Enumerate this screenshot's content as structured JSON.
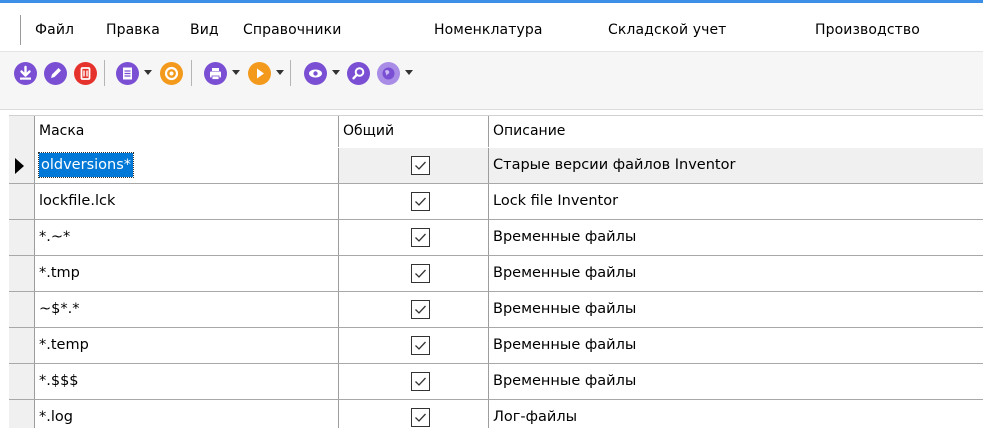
{
  "menu": [
    {
      "id": "file",
      "label": "Файл"
    },
    {
      "id": "edit",
      "label": "Правка"
    },
    {
      "id": "view",
      "label": "Вид"
    },
    {
      "id": "references",
      "label": "Справочники"
    },
    {
      "id": "nomenclature",
      "label": "Номенклатура"
    },
    {
      "id": "warehouse",
      "label": "Складской учет"
    },
    {
      "id": "production",
      "label": "Производство"
    }
  ],
  "toolbar": {
    "icons": [
      "download-icon",
      "edit-icon",
      "delete-icon",
      "document-icon",
      "refresh-icon",
      "print-icon",
      "play-icon",
      "view-icon",
      "search-icon",
      "globe-icon"
    ],
    "colors": {
      "purple": "#7a4fd3",
      "red": "#e5322d",
      "orange": "#f39a1c",
      "blue_accent": "#3d8ee6"
    }
  },
  "grid": {
    "columns": [
      "Маска",
      "Общий",
      "Описание"
    ],
    "rows": [
      {
        "mask": "oldversions*",
        "common": true,
        "description": "Старые версии файлов Inventor",
        "selected": true
      },
      {
        "mask": "lockfile.lck",
        "common": true,
        "description": "Lock file Inventor",
        "selected": false
      },
      {
        "mask": "*.~*",
        "common": true,
        "description": "Временные файлы",
        "selected": false
      },
      {
        "mask": "*.tmp",
        "common": true,
        "description": "Временные файлы",
        "selected": false
      },
      {
        "mask": "~$*.*",
        "common": true,
        "description": "Временные файлы",
        "selected": false
      },
      {
        "mask": "*.temp",
        "common": true,
        "description": "Временные файлы",
        "selected": false
      },
      {
        "mask": "*.$$$",
        "common": true,
        "description": "Временные файлы",
        "selected": false
      },
      {
        "mask": "*.log",
        "common": true,
        "description": "Лог-файлы",
        "selected": false
      }
    ]
  }
}
